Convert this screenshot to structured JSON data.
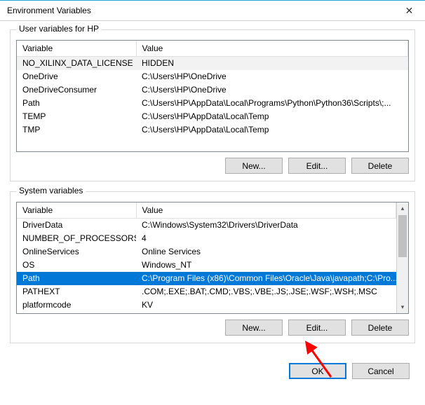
{
  "window": {
    "title": "Environment Variables",
    "close_glyph": "✕"
  },
  "groups": {
    "user": {
      "label": "User variables for HP",
      "col_variable": "Variable",
      "col_value": "Value",
      "rows": [
        {
          "name": "NO_XILINX_DATA_LICENSE",
          "value": "HIDDEN"
        },
        {
          "name": "OneDrive",
          "value": "C:\\Users\\HP\\OneDrive"
        },
        {
          "name": "OneDriveConsumer",
          "value": "C:\\Users\\HP\\OneDrive"
        },
        {
          "name": "Path",
          "value": "C:\\Users\\HP\\AppData\\Local\\Programs\\Python\\Python36\\Scripts\\;..."
        },
        {
          "name": "TEMP",
          "value": "C:\\Users\\HP\\AppData\\Local\\Temp"
        },
        {
          "name": "TMP",
          "value": "C:\\Users\\HP\\AppData\\Local\\Temp"
        }
      ],
      "buttons": {
        "new": "New...",
        "edit": "Edit...",
        "delete": "Delete"
      }
    },
    "system": {
      "label": "System variables",
      "col_variable": "Variable",
      "col_value": "Value",
      "rows": [
        {
          "name": "DriverData",
          "value": "C:\\Windows\\System32\\Drivers\\DriverData"
        },
        {
          "name": "NUMBER_OF_PROCESSORS",
          "value": "4"
        },
        {
          "name": "OnlineServices",
          "value": "Online Services"
        },
        {
          "name": "OS",
          "value": "Windows_NT"
        },
        {
          "name": "Path",
          "value": "C:\\Program Files (x86)\\Common Files\\Oracle\\Java\\javapath;C:\\Pro..."
        },
        {
          "name": "PATHEXT",
          "value": ".COM;.EXE;.BAT;.CMD;.VBS;.VBE;.JS;.JSE;.WSF;.WSH;.MSC"
        },
        {
          "name": "platformcode",
          "value": "KV"
        }
      ],
      "selected_index": 4,
      "buttons": {
        "new": "New...",
        "edit": "Edit...",
        "delete": "Delete"
      }
    }
  },
  "footer": {
    "ok": "OK",
    "cancel": "Cancel"
  }
}
